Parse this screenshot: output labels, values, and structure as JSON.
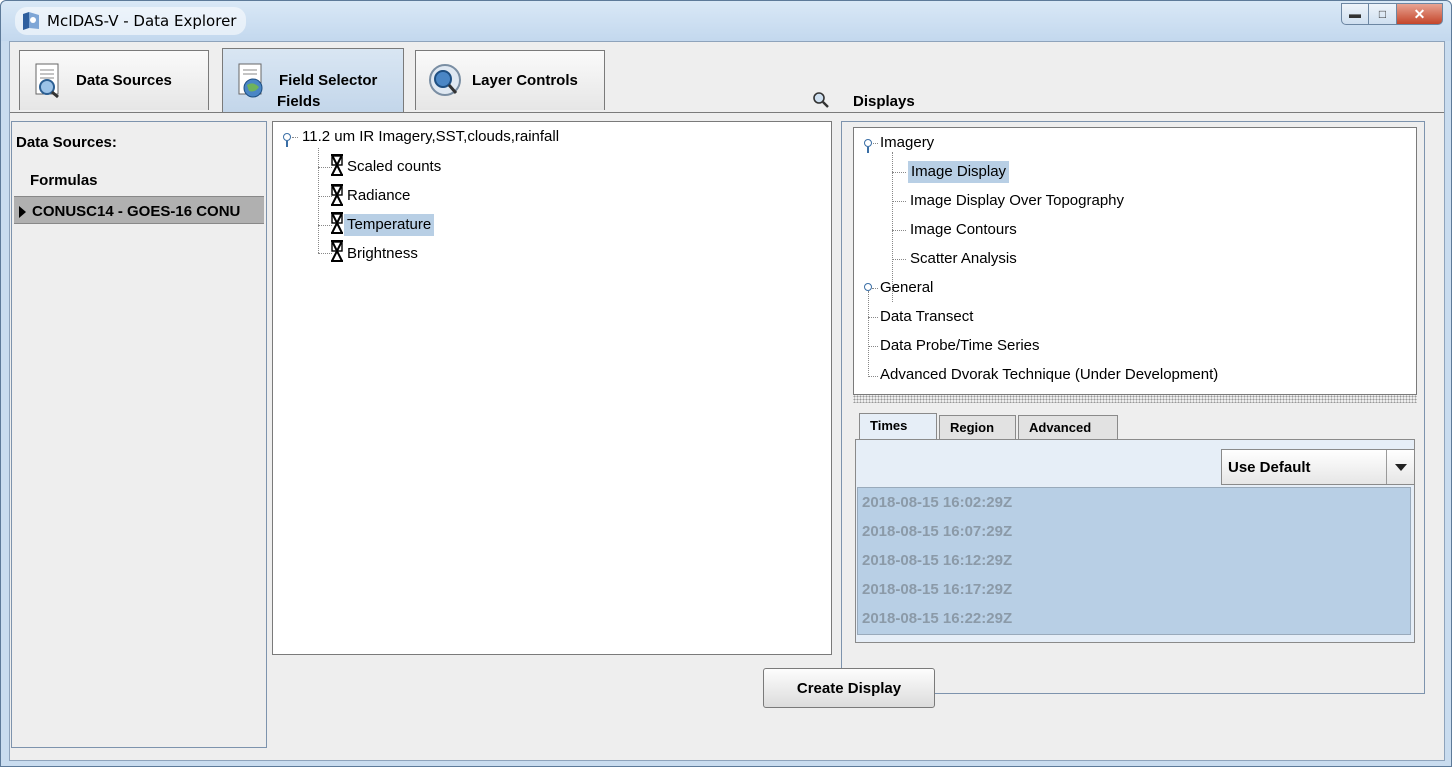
{
  "window": {
    "title": "McIDAS-V - Data Explorer"
  },
  "main_tabs": [
    {
      "label": "Data Sources",
      "icon": "document-magnifier-icon"
    },
    {
      "label": "Field Selector",
      "icon": "document-globe-icon",
      "active": true
    },
    {
      "label": "Layer Controls",
      "icon": "globe-magnifier-icon"
    }
  ],
  "data_sources": {
    "header": "Data Sources:",
    "items": [
      "Formulas",
      "CONUSC14 - GOES-16 CONU"
    ],
    "selected": "CONUSC14 - GOES-16 CONU"
  },
  "fields": {
    "header": "Fields",
    "root": "11.2 um IR Imagery,SST,clouds,rainfall",
    "children": [
      "Scaled counts",
      "Radiance",
      "Temperature",
      "Brightness"
    ],
    "selected": "Temperature"
  },
  "displays": {
    "header": "Displays",
    "groups": [
      {
        "label": "Imagery",
        "children": [
          "Image Display",
          "Image Display Over Topography",
          "Image Contours",
          "Scatter Analysis"
        ]
      },
      {
        "label": "General",
        "children": []
      }
    ],
    "items": [
      "Data Transect",
      "Data Probe/Time Series",
      "Advanced Dvorak Technique (Under Development)"
    ],
    "selected": "Image Display"
  },
  "settings_tabs": [
    "Times",
    "Region",
    "Advanced"
  ],
  "times": {
    "mode": "Use Default",
    "list": [
      "2018-08-15 16:02:29Z",
      "2018-08-15 16:07:29Z",
      "2018-08-15 16:12:29Z",
      "2018-08-15 16:17:29Z",
      "2018-08-15 16:22:29Z"
    ]
  },
  "create_button": "Create Display"
}
